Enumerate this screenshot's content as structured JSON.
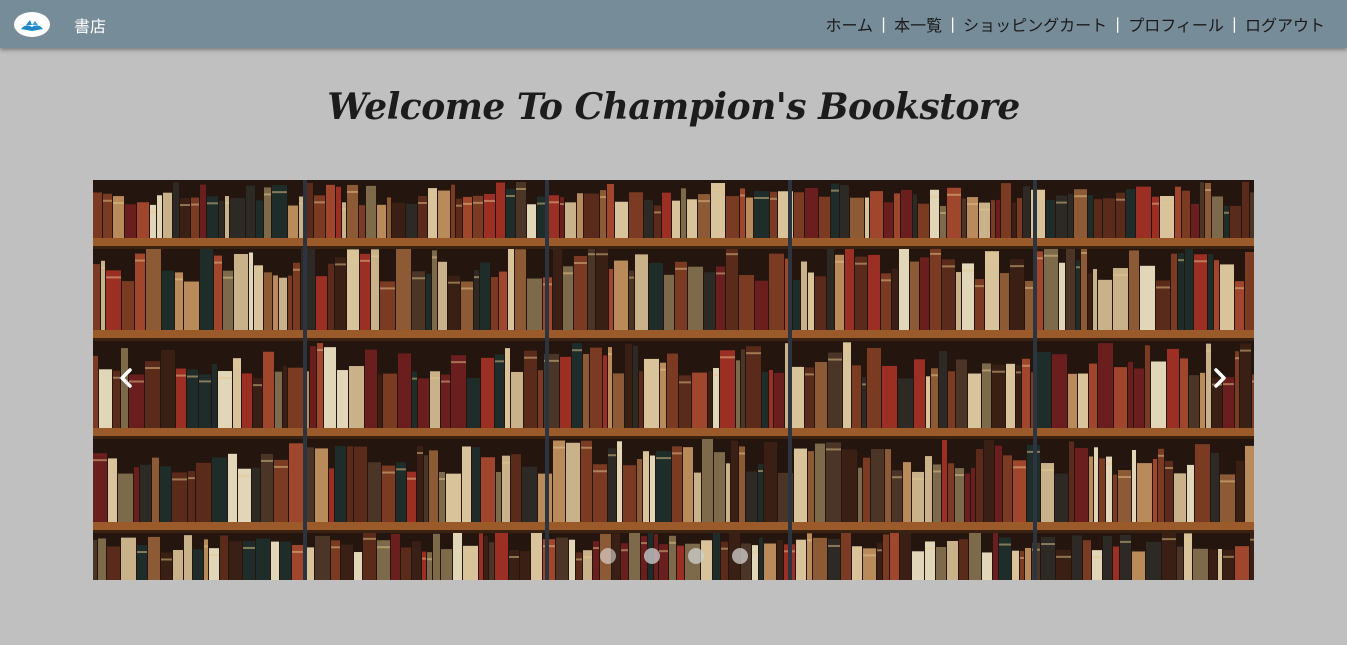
{
  "navbar": {
    "brand": "書店",
    "links": [
      "ホーム",
      "本一覧",
      "ショッピングカート",
      "プロフィール",
      "ログアウト"
    ],
    "separator": "|",
    "colors": {
      "background": "#778c99",
      "brand_text": "#ffffff",
      "link_text": "#1a1a1a"
    }
  },
  "page": {
    "title": "Welcome To Champion's Bookstore",
    "background": "#c0c0c0"
  },
  "carousel": {
    "slide_count": 4,
    "active_index": 0,
    "icons": {
      "prev": "chevron-left-icon",
      "next": "chevron-right-icon"
    }
  },
  "logo": {
    "icon": "open-book-bird-icon"
  }
}
